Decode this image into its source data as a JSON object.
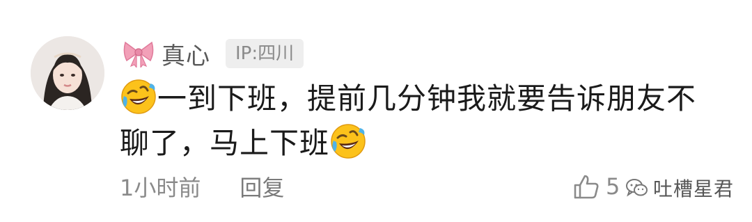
{
  "comment": {
    "username": "真心",
    "ip_location": "IP:四川",
    "content_line1": "一到下班，提前几分钟我就要告诉朋友不",
    "content_line2": "聊了，马上下班",
    "time": "1小时前",
    "reply_label": "回复",
    "like_count": "5"
  },
  "watermark": {
    "text": "吐槽星君"
  },
  "icons": {
    "username_prefix": "pink-bow-icon",
    "emoji": "rolling-laughing-emoji",
    "like": "thumbs-up-icon",
    "watermark": "wechat-icon"
  },
  "colors": {
    "username": "#5a5a5a",
    "content": "#1a1a1a",
    "meta": "#8a8a8a",
    "badge_bg": "#eeeeee",
    "bow": "#f2a0b8"
  }
}
